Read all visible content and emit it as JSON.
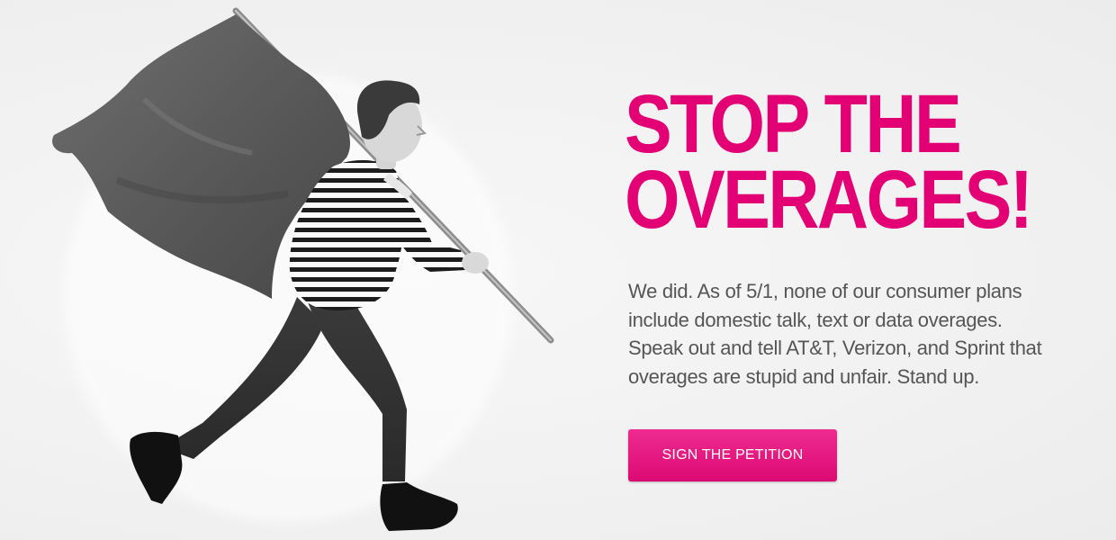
{
  "hero": {
    "headline_line1": "STOP THE",
    "headline_line2": "OVERAGES!",
    "body_lines": [
      "We did. As of 5/1, none of our consumer plans",
      "include domestic talk, text or data overages.",
      "Speak out and tell AT&T, Verizon, and Sprint that",
      "overages are stupid and unfair. Stand up."
    ],
    "cta_label": "SIGN THE PETITION"
  },
  "colors": {
    "brand_magenta": "#e20074",
    "body_text": "#555555",
    "background": "#f2f2f2"
  }
}
